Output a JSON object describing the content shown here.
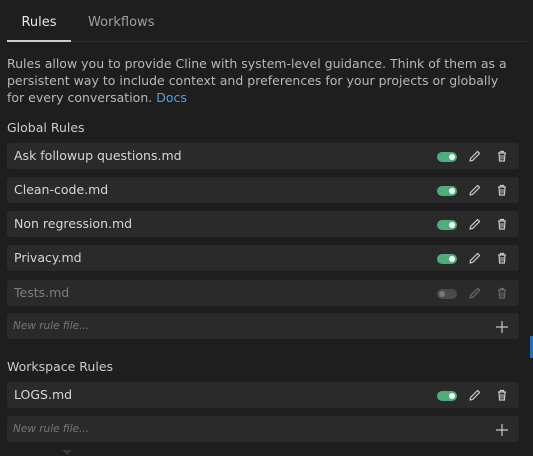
{
  "tabs": [
    {
      "label": "Rules",
      "active": true
    },
    {
      "label": "Workflows",
      "active": false
    }
  ],
  "description": {
    "text": "Rules allow you to provide Cline with system-level guidance. Think of them as a persistent way to include context and preferences for your projects or globally for every conversation.",
    "link_label": "Docs"
  },
  "global_rules": {
    "title": "Global Rules",
    "items": [
      {
        "name": "Ask followup questions.md",
        "enabled": true
      },
      {
        "name": "Clean-code.md",
        "enabled": true
      },
      {
        "name": "Non regression.md",
        "enabled": true
      },
      {
        "name": "Privacy.md",
        "enabled": true
      },
      {
        "name": "Tests.md",
        "enabled": false
      }
    ],
    "new_placeholder": "New rule file..."
  },
  "workspace_rules": {
    "title": "Workspace Rules",
    "items": [
      {
        "name": "LOGS.md",
        "enabled": true
      }
    ],
    "new_placeholder": "New rule file..."
  },
  "colors": {
    "toggle_on": "#4caf7a",
    "link": "#4aa3f0",
    "background": "#1e1e1e",
    "row_background": "#2a2a2a"
  }
}
